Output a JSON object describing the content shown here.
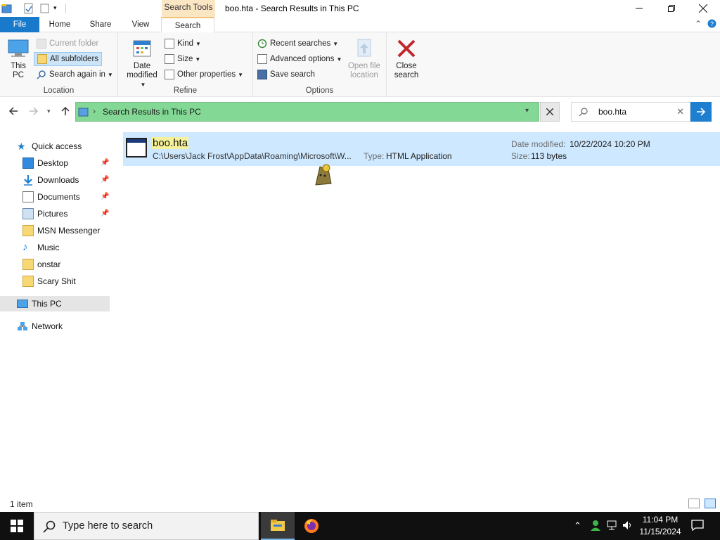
{
  "window": {
    "title": "boo.hta - Search Results in This PC",
    "context_tab": "Search Tools"
  },
  "tabs": [
    {
      "label": "File"
    },
    {
      "label": "Home"
    },
    {
      "label": "Share"
    },
    {
      "label": "View"
    },
    {
      "label": "Search"
    }
  ],
  "ribbon": {
    "location": {
      "label": "Location",
      "this_pc": "This PC",
      "current_folder": "Current folder",
      "all_subfolders": "All subfolders",
      "search_again_in": "Search again in"
    },
    "refine": {
      "label": "Refine",
      "date_modified": "Date modified",
      "kind": "Kind",
      "size": "Size",
      "other_properties": "Other properties"
    },
    "options": {
      "label": "Options",
      "recent_searches": "Recent searches",
      "advanced_options": "Advanced options",
      "save_search": "Save search",
      "open_file_location": "Open file location",
      "close_search": "Close search"
    }
  },
  "address": {
    "path": "Search Results in This PC",
    "search_query": "boo.hta",
    "highlight_color": "#84d895"
  },
  "nav": {
    "quick_access": "Quick access",
    "items": [
      {
        "label": "Desktop",
        "pinned": true
      },
      {
        "label": "Downloads",
        "pinned": true
      },
      {
        "label": "Documents",
        "pinned": true
      },
      {
        "label": "Pictures",
        "pinned": true
      },
      {
        "label": "MSN Messenger",
        "pinned": false
      },
      {
        "label": "Music",
        "pinned": false
      },
      {
        "label": "onstar",
        "pinned": false
      },
      {
        "label": "Scary Shit",
        "pinned": false
      }
    ],
    "this_pc": "This PC",
    "network": "Network"
  },
  "results": [
    {
      "name": "boo.hta",
      "path": "C:\\Users\\Jack Frost\\AppData\\Roaming\\Microsoft\\W...",
      "type_label": "Type:",
      "type": "HTML Application",
      "modified_label": "Date modified:",
      "modified": "10/22/2024 10:20 PM",
      "size_label": "Size:",
      "size": "113 bytes"
    }
  ],
  "status": {
    "item_count": "1 item"
  },
  "taskbar": {
    "search_placeholder": "Type here to search",
    "time": "11:04 PM",
    "date": "11/15/2024"
  }
}
